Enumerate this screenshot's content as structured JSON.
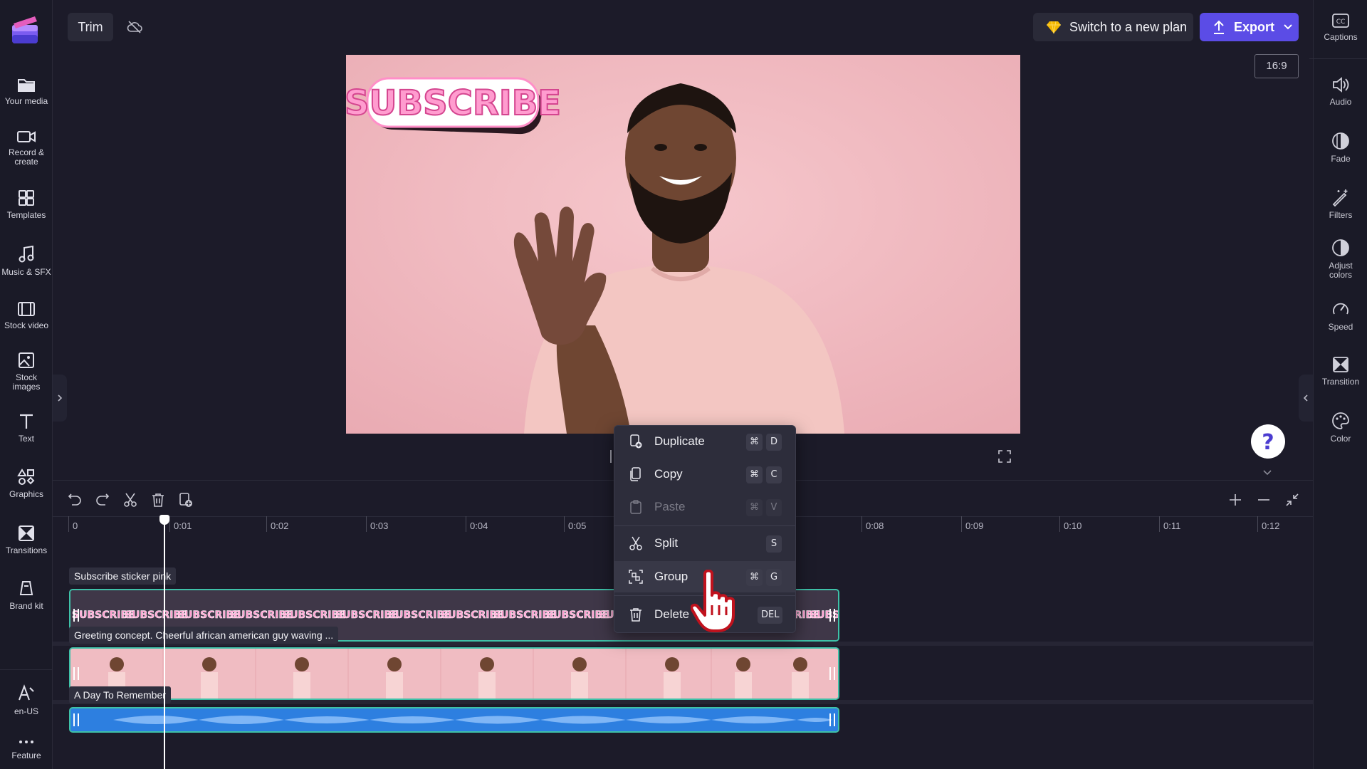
{
  "app": {
    "name": "Clipchamp"
  },
  "sidebar": {
    "items": [
      {
        "label": "Your media",
        "icon": "folder-icon"
      },
      {
        "label": "Record & create",
        "icon": "video-camera-icon"
      },
      {
        "label": "Templates",
        "icon": "templates-icon"
      },
      {
        "label": "Music & SFX",
        "icon": "music-note-icon"
      },
      {
        "label": "Stock video",
        "icon": "film-icon"
      },
      {
        "label": "Stock images",
        "icon": "image-icon"
      },
      {
        "label": "Text",
        "icon": "text-icon"
      },
      {
        "label": "Graphics",
        "icon": "shapes-icon"
      },
      {
        "label": "Transitions",
        "icon": "transition-icon"
      },
      {
        "label": "Brand kit",
        "icon": "brand-kit-icon"
      }
    ],
    "bottom": [
      {
        "label": "en-US",
        "icon": "language-icon"
      },
      {
        "label": "Feature",
        "icon": "more-icon"
      }
    ]
  },
  "topbar": {
    "trim_label": "Trim",
    "plan_button": "Switch to a new plan",
    "export_button": "Export",
    "aspect_ratio": "16:9"
  },
  "right_panel": {
    "items": [
      {
        "label": "Captions",
        "icon": "captions-icon"
      },
      {
        "label": "Audio",
        "icon": "speaker-icon"
      },
      {
        "label": "Fade",
        "icon": "fade-icon"
      },
      {
        "label": "Filters",
        "icon": "magic-wand-icon"
      },
      {
        "label": "Adjust colors",
        "icon": "contrast-icon"
      },
      {
        "label": "Speed",
        "icon": "speedometer-icon"
      },
      {
        "label": "Transition",
        "icon": "transition-icon"
      },
      {
        "label": "Color",
        "icon": "palette-icon"
      }
    ]
  },
  "preview": {
    "sticker_text": "SUBSCRIBE"
  },
  "timeline": {
    "ticks": [
      "0",
      "0:01",
      "0:02",
      "0:03",
      "0:04",
      "0:05",
      "0:08",
      "0:09",
      "0:10",
      "0:11",
      "0:12"
    ],
    "clips": {
      "sticker": "Subscribe sticker pink",
      "video": "Greeting concept. Cheerful african american guy waving ...",
      "audio": "A Day To Remember"
    }
  },
  "context_menu": {
    "items": [
      {
        "label": "Duplicate",
        "shortcut": [
          "⌘",
          "D"
        ],
        "icon": "duplicate-icon",
        "enabled": true
      },
      {
        "label": "Copy",
        "shortcut": [
          "⌘",
          "C"
        ],
        "icon": "copy-icon",
        "enabled": true
      },
      {
        "label": "Paste",
        "shortcut": [
          "⌘",
          "V"
        ],
        "icon": "paste-icon",
        "enabled": false
      },
      {
        "label": "Split",
        "shortcut": [
          "S"
        ],
        "icon": "scissors-icon",
        "enabled": true
      },
      {
        "label": "Group",
        "shortcut": [
          "⌘",
          "G"
        ],
        "icon": "group-icon",
        "enabled": true
      },
      {
        "label": "Delete",
        "shortcut": [
          "DEL"
        ],
        "icon": "trash-icon",
        "enabled": true
      }
    ]
  },
  "colors": {
    "accent": "#5b4ce6",
    "clip_teal": "#3ec1a8",
    "audio_blue": "#2d7fe0",
    "preview_bg": "#f0bcc2"
  }
}
